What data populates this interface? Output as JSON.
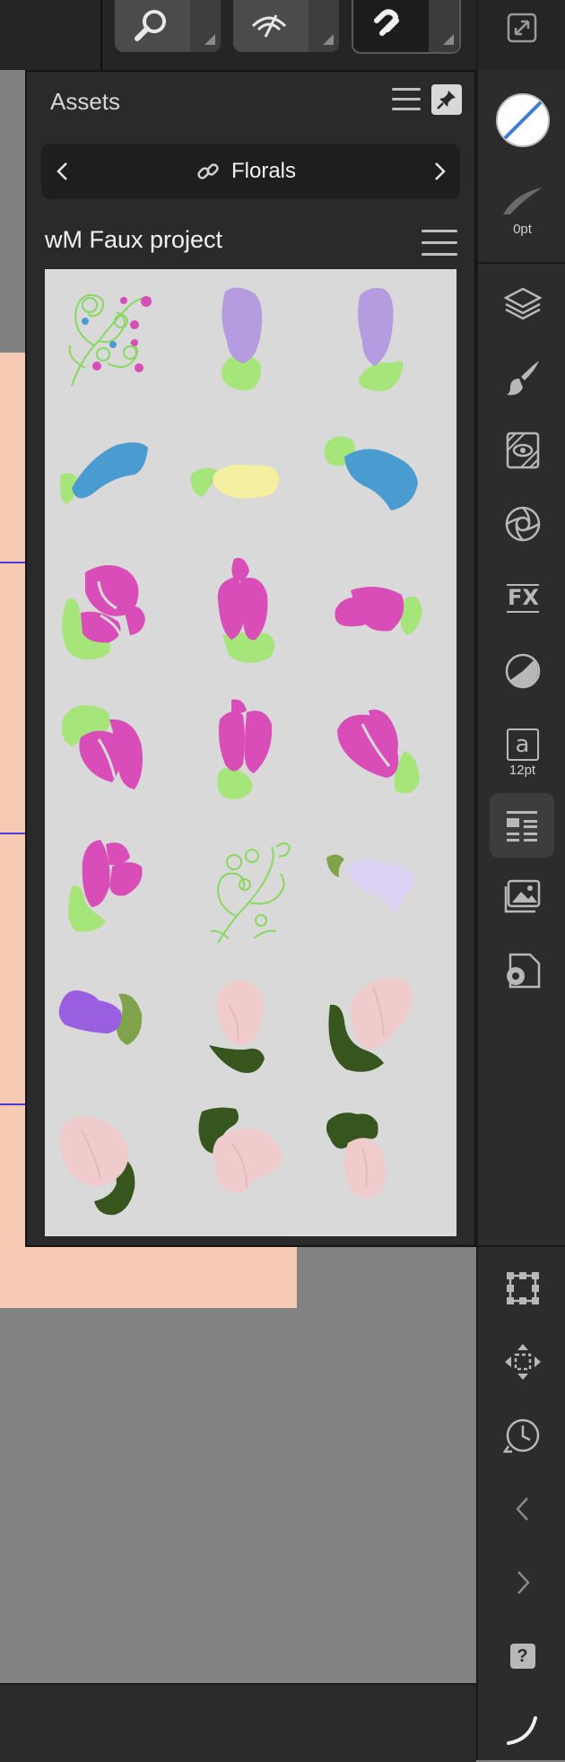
{
  "toolbar": {
    "buttons": [
      {
        "name": "zoom-tool-button",
        "icon": "magnifier-icon"
      },
      {
        "name": "view-quality-button",
        "icon": "eye-icon"
      },
      {
        "name": "snapping-button",
        "icon": "magnet-icon",
        "selected": true
      }
    ],
    "right_icon": "expand-icon"
  },
  "assets_panel": {
    "title": "Assets",
    "category": "Florals",
    "project": "wM Faux project",
    "asset_count": 21
  },
  "right_sidebar": {
    "stroke_width_label": "0pt",
    "font_size_label": "12pt",
    "text_glyph": "a",
    "help_glyph": "?",
    "tools": [
      "stroke-color-icon",
      "stroke-width-icon",
      "layers-icon",
      "brushes-icon",
      "adjustments-icon",
      "effects-icon",
      "fx-icon",
      "transparency-icon",
      "text-styles-icon",
      "assets-icon",
      "stock-icon",
      "settings-icon",
      "transform-icon",
      "move-icon",
      "history-icon",
      "undo-icon",
      "redo-icon",
      "help-icon",
      "studio-toggle-icon"
    ]
  },
  "colors": {
    "panel": "#2a2a2a",
    "tile_bg": "#d9d9d9",
    "magenta": "#d84db8",
    "lavender": "#b59be0",
    "blue": "#4a9bd0",
    "leaf_green": "#a6e57a",
    "dark_green": "#36561d",
    "blush": "#f0cbcb",
    "peach": "#f7cbb3"
  }
}
